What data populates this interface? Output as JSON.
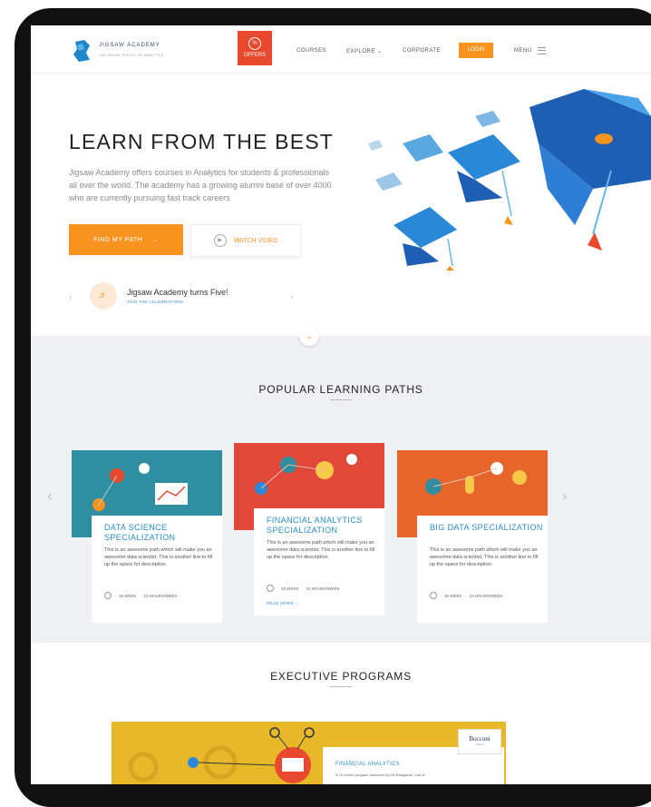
{
  "nav": {
    "logo_title": "JIGSAW ACADEMY",
    "logo_tagline": "THE ONLINE SCHOOL OF ANALYTICS",
    "offers_label": "OFFERS",
    "offers_symbol": "%",
    "courses": "COURSES",
    "explore": "EXPLORE",
    "explore_chevron": "⌄",
    "corporate": "CORPORATE",
    "login": "LOGIN",
    "menu": "MENU"
  },
  "hero": {
    "title": "LEARN FROM THE BEST",
    "description": "Jigsaw Academy offers courses in Analytics for students & professionals all over the world. The academy has a growing alumni base of over 4000 who are currently pursuing fast track careers",
    "find_path": "FIND MY PATH",
    "find_path_arrow": "→",
    "watch_video": "WATCH VIDEO",
    "play_symbol": "▶"
  },
  "news": {
    "prev": "‹",
    "next": "›",
    "title": "Jigsaw Academy turns Five!",
    "link": "JOIN THE CELEBRATIONS",
    "scroll_down": "⌄"
  },
  "popular": {
    "title": "POPULAR LEARNING PATHS",
    "prev": "‹",
    "next": "›",
    "cards": [
      {
        "title": "DATA SCIENCE SPECIALIZATION",
        "desc": "This is an awesome path which will make you an awesome data scientist. This is another line to fill up the space for description.",
        "weeks": "16 WEEK",
        "hours": "10 HOURS/WEEK",
        "color": "#2f8ea0"
      },
      {
        "title": "FINANCIAL ANALYTICS SPECIALIZATION",
        "desc": "This is an awesome path which will make you an awesome data scientist. This is another line to fill up the space for description.",
        "weeks": "16 WEEK",
        "hours": "10 HOURS/WEEK",
        "read_more": "READ MORE →",
        "color": "#e0483a"
      },
      {
        "title": "BIG DATA SPECIALIZATION",
        "desc": "This is an awesome path which will make you an awesome data scientist. This is another line to fill up the space for description.",
        "weeks": "16 WEEK",
        "hours": "10 HOURS/WEEK",
        "color": "#e7642b"
      }
    ]
  },
  "executive": {
    "title": "EXECUTIVE PROGRAMS",
    "card_title": "FINANCIAL ANALYTICS",
    "card_desc": "A 10-month program launched by IIM Bangalore, one of",
    "partner_name": "Bocconi",
    "partner_sub": "INDIA",
    "banner_color": "#e6b82a"
  }
}
